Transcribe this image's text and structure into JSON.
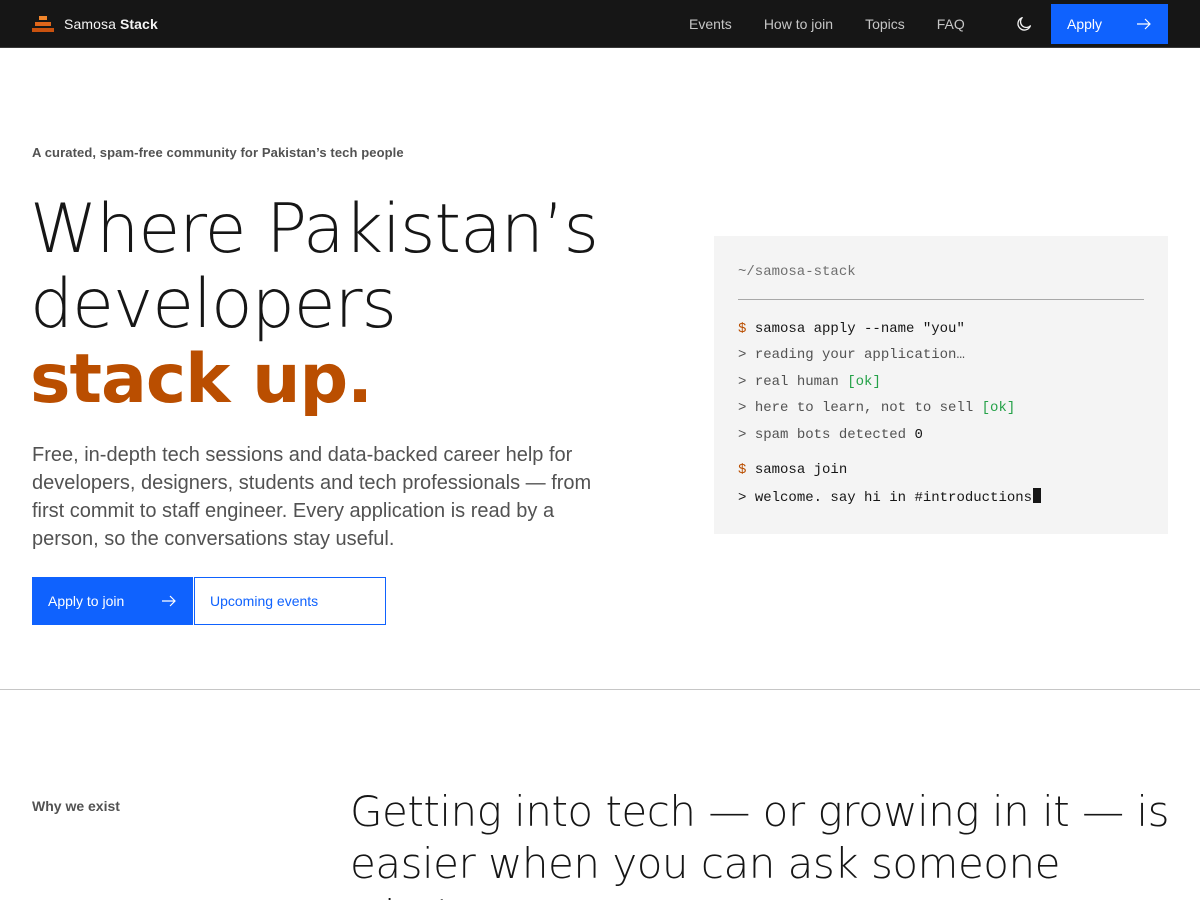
{
  "nav": {
    "brand_regular": "Samosa",
    "brand_bold": "Stack",
    "links": [
      "Events",
      "How to join",
      "Topics",
      "FAQ"
    ],
    "theme_icon": "moon-icon",
    "apply_label": "Apply",
    "apply_icon": "arrow-right-icon"
  },
  "hero": {
    "eyebrow": "A curated, spam-free community for Pakistan’s tech people",
    "title_line1": "Where Pakistan’s",
    "title_line2": "developers",
    "title_accent": "stack up.",
    "description": "Free, in-depth tech sessions and data-backed career help for developers, designers, students and tech professionals — from first commit to staff engineer. Every application is read by a person, so the conversations stay useful.",
    "primary_button": "Apply to join",
    "secondary_button": "Upcoming events"
  },
  "terminal": {
    "title": "~/samosa-stack",
    "prompt": "$",
    "arrow": ">",
    "cmd1": "samosa apply --name \"you\"",
    "out1": "reading your application…",
    "out2_text": "real human",
    "out2_status": "[ok]",
    "out3_text": "here to learn, not to sell",
    "out3_status": "[ok]",
    "out4_text": "spam bots detected",
    "out4_value": "0",
    "cmd2": "samosa join",
    "out5": "welcome. say hi in #introductions"
  },
  "section": {
    "label": "Why we exist",
    "heading": "Getting into tech — or growing in it — is easier when you can ask someone who’s"
  },
  "colors": {
    "nav_bg": "#161616",
    "primary": "#0f62fe",
    "accent": "#ba4e00",
    "ok": "#24a148",
    "terminal_bg": "#f4f4f4"
  }
}
